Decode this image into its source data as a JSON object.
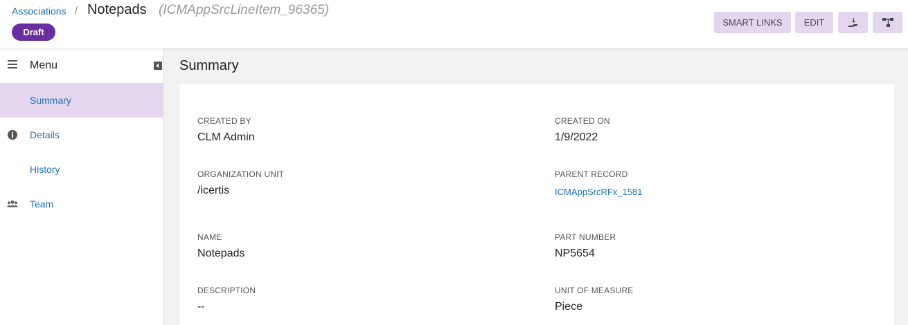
{
  "header": {
    "breadcrumb_link": "Associations",
    "breadcrumb_separator": "/",
    "title": "Notepads",
    "subtitle": "(ICMAppSrcLineItem_96365)",
    "status_badge": "Draft",
    "buttons": {
      "smart_links": "SMART LINKS",
      "edit": "EDIT",
      "sign_icon": "hand-sign-icon",
      "hierarchy_icon": "hierarchy-icon"
    }
  },
  "sidebar": {
    "menu_label": "Menu",
    "items": [
      {
        "label": "Summary",
        "icon": "none",
        "active": true
      },
      {
        "label": "Details",
        "icon": "info-icon",
        "active": false
      },
      {
        "label": "History",
        "icon": "none",
        "active": false
      },
      {
        "label": "Team",
        "icon": "team-icon",
        "active": false
      }
    ]
  },
  "main": {
    "page_title": "Summary",
    "fields": {
      "created_by": {
        "label": "CREATED BY",
        "value": "CLM Admin"
      },
      "created_on": {
        "label": "CREATED ON",
        "value": "1/9/2022"
      },
      "organization_unit": {
        "label": "ORGANIZATION UNIT",
        "value": "/icertis"
      },
      "parent_record": {
        "label": "PARENT RECORD",
        "value": "ICMAppSrcRFx_1581"
      },
      "name": {
        "label": "NAME",
        "value": "Notepads"
      },
      "part_number": {
        "label": "PART NUMBER",
        "value": "NP5654"
      },
      "description": {
        "label": "DESCRIPTION",
        "value": "--"
      },
      "unit_of_measure": {
        "label": "UNIT OF MEASURE",
        "value": "Piece"
      }
    }
  },
  "colors": {
    "accent_purple": "#6a2ea0",
    "button_bg": "#e3d6ee",
    "link_blue": "#1f6fb5",
    "main_bg": "#f2f2f2"
  }
}
